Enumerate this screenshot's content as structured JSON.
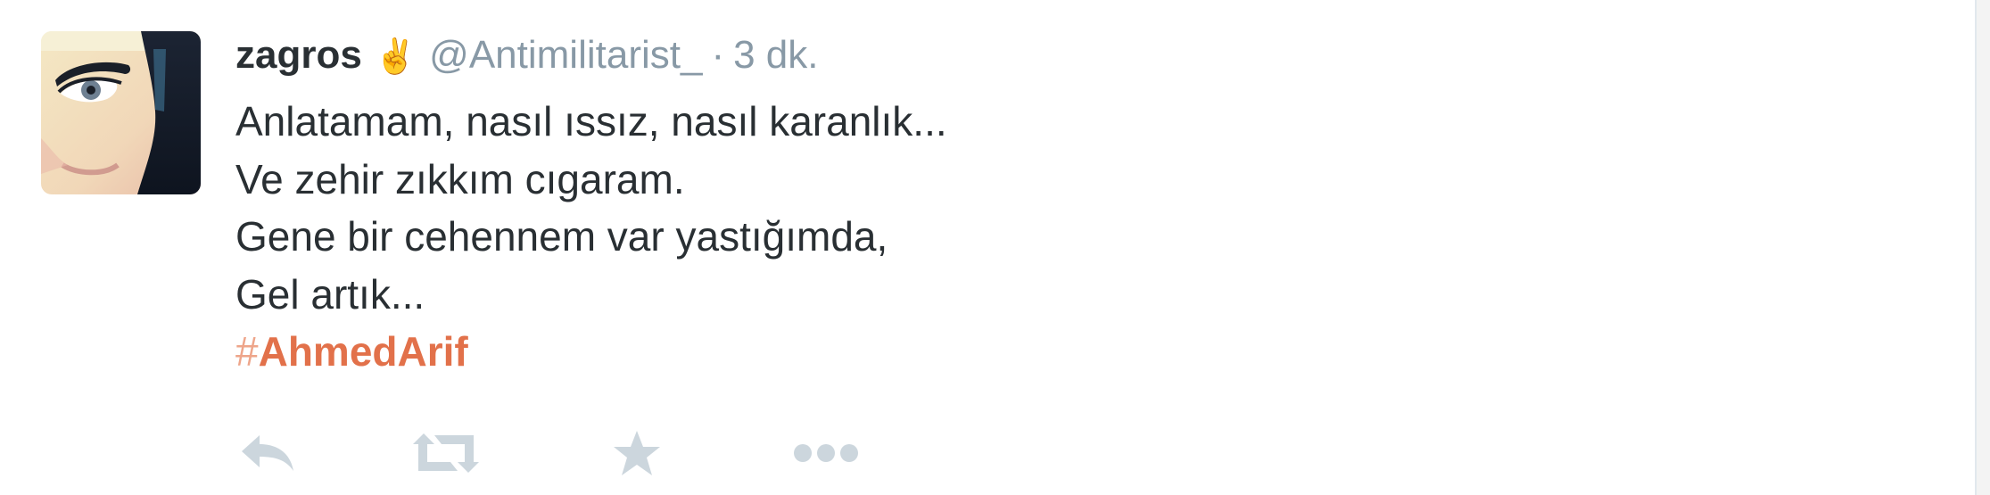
{
  "tweet": {
    "user": {
      "fullname": "zagros",
      "name_symbol": "✌",
      "username": "@Antimilitarist_",
      "avatar_icon": "profile-photo-avatar"
    },
    "separator": "·",
    "timestamp": "3 dk.",
    "text_lines": [
      "Anlatamam, nasıl ıssız, nasıl karanlık...",
      "Ve zehir zıkkım cıgaram.",
      "Gene bir cehennem var yastığımda,",
      "Gel artık..."
    ],
    "hashtag": {
      "mark": "#",
      "word": "AhmedArif"
    },
    "actions": [
      {
        "name": "reply",
        "icon": "reply-icon"
      },
      {
        "name": "retweet",
        "icon": "retweet-icon"
      },
      {
        "name": "favorite",
        "icon": "star-icon"
      },
      {
        "name": "more",
        "icon": "more-dots-icon"
      }
    ],
    "colors": {
      "text": "#292f33",
      "muted": "#8899a6",
      "hashtag": "#e2714a",
      "action_icons": "#ccd6dd"
    }
  }
}
